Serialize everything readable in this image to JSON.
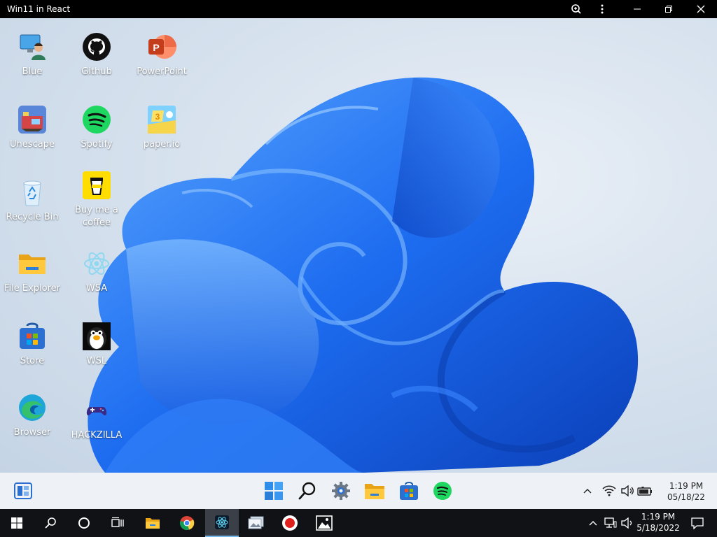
{
  "window": {
    "title": "Win11 in React"
  },
  "desktop_icons": [
    {
      "label": "Blue",
      "icon": "computer-user-icon"
    },
    {
      "label": "Github",
      "icon": "github-icon"
    },
    {
      "label": "PowerPoint",
      "icon": "powerpoint-icon"
    },
    {
      "label": "Unescape",
      "icon": "unescape-game-icon"
    },
    {
      "label": "Spotify",
      "icon": "spotify-icon"
    },
    {
      "label": "paper.io",
      "icon": "paperio-icon"
    },
    {
      "label": "Recycle Bin",
      "icon": "recycle-bin-icon"
    },
    {
      "label": "Buy me a coffee",
      "icon": "coffee-cup-icon"
    },
    {
      "label": "File Explorer",
      "icon": "folder-icon"
    },
    {
      "label": "WSA",
      "icon": "react-atom-icon"
    },
    {
      "label": "Store",
      "icon": "store-bag-icon"
    },
    {
      "label": "WSL",
      "icon": "linux-penguin-icon"
    },
    {
      "label": "Browser",
      "icon": "edge-browser-icon"
    },
    {
      "label": "HACKZILLA",
      "icon": "gamepad-icon"
    }
  ],
  "w11_taskbar": {
    "items": [
      "widgets-icon",
      "start-windows-icon",
      "search-icon",
      "settings-gear-icon",
      "file-explorer-icon",
      "store-icon",
      "spotify-icon"
    ],
    "tray": [
      "chevron-up-icon",
      "wifi-icon",
      "volume-icon",
      "battery-icon"
    ],
    "time": "1:19 PM",
    "date": "05/18/22"
  },
  "host_taskbar": {
    "items": [
      "windows-start-icon",
      "search-icon",
      "cortana-icon",
      "task-view-icon",
      "file-explorer-icon",
      "chrome-icon",
      "react-app-icon",
      "photos-icon",
      "record-icon",
      "image-icon"
    ],
    "tray": [
      "chevron-up-icon",
      "network-icon",
      "volume-icon",
      "notification-icon"
    ],
    "time": "1:19 PM",
    "date": "5/18/2022"
  },
  "colors": {
    "bloom_blue": "#1a66e8",
    "bloom_light": "#4c9bff",
    "taskbar": "#eef2f6",
    "host": "#101216"
  }
}
